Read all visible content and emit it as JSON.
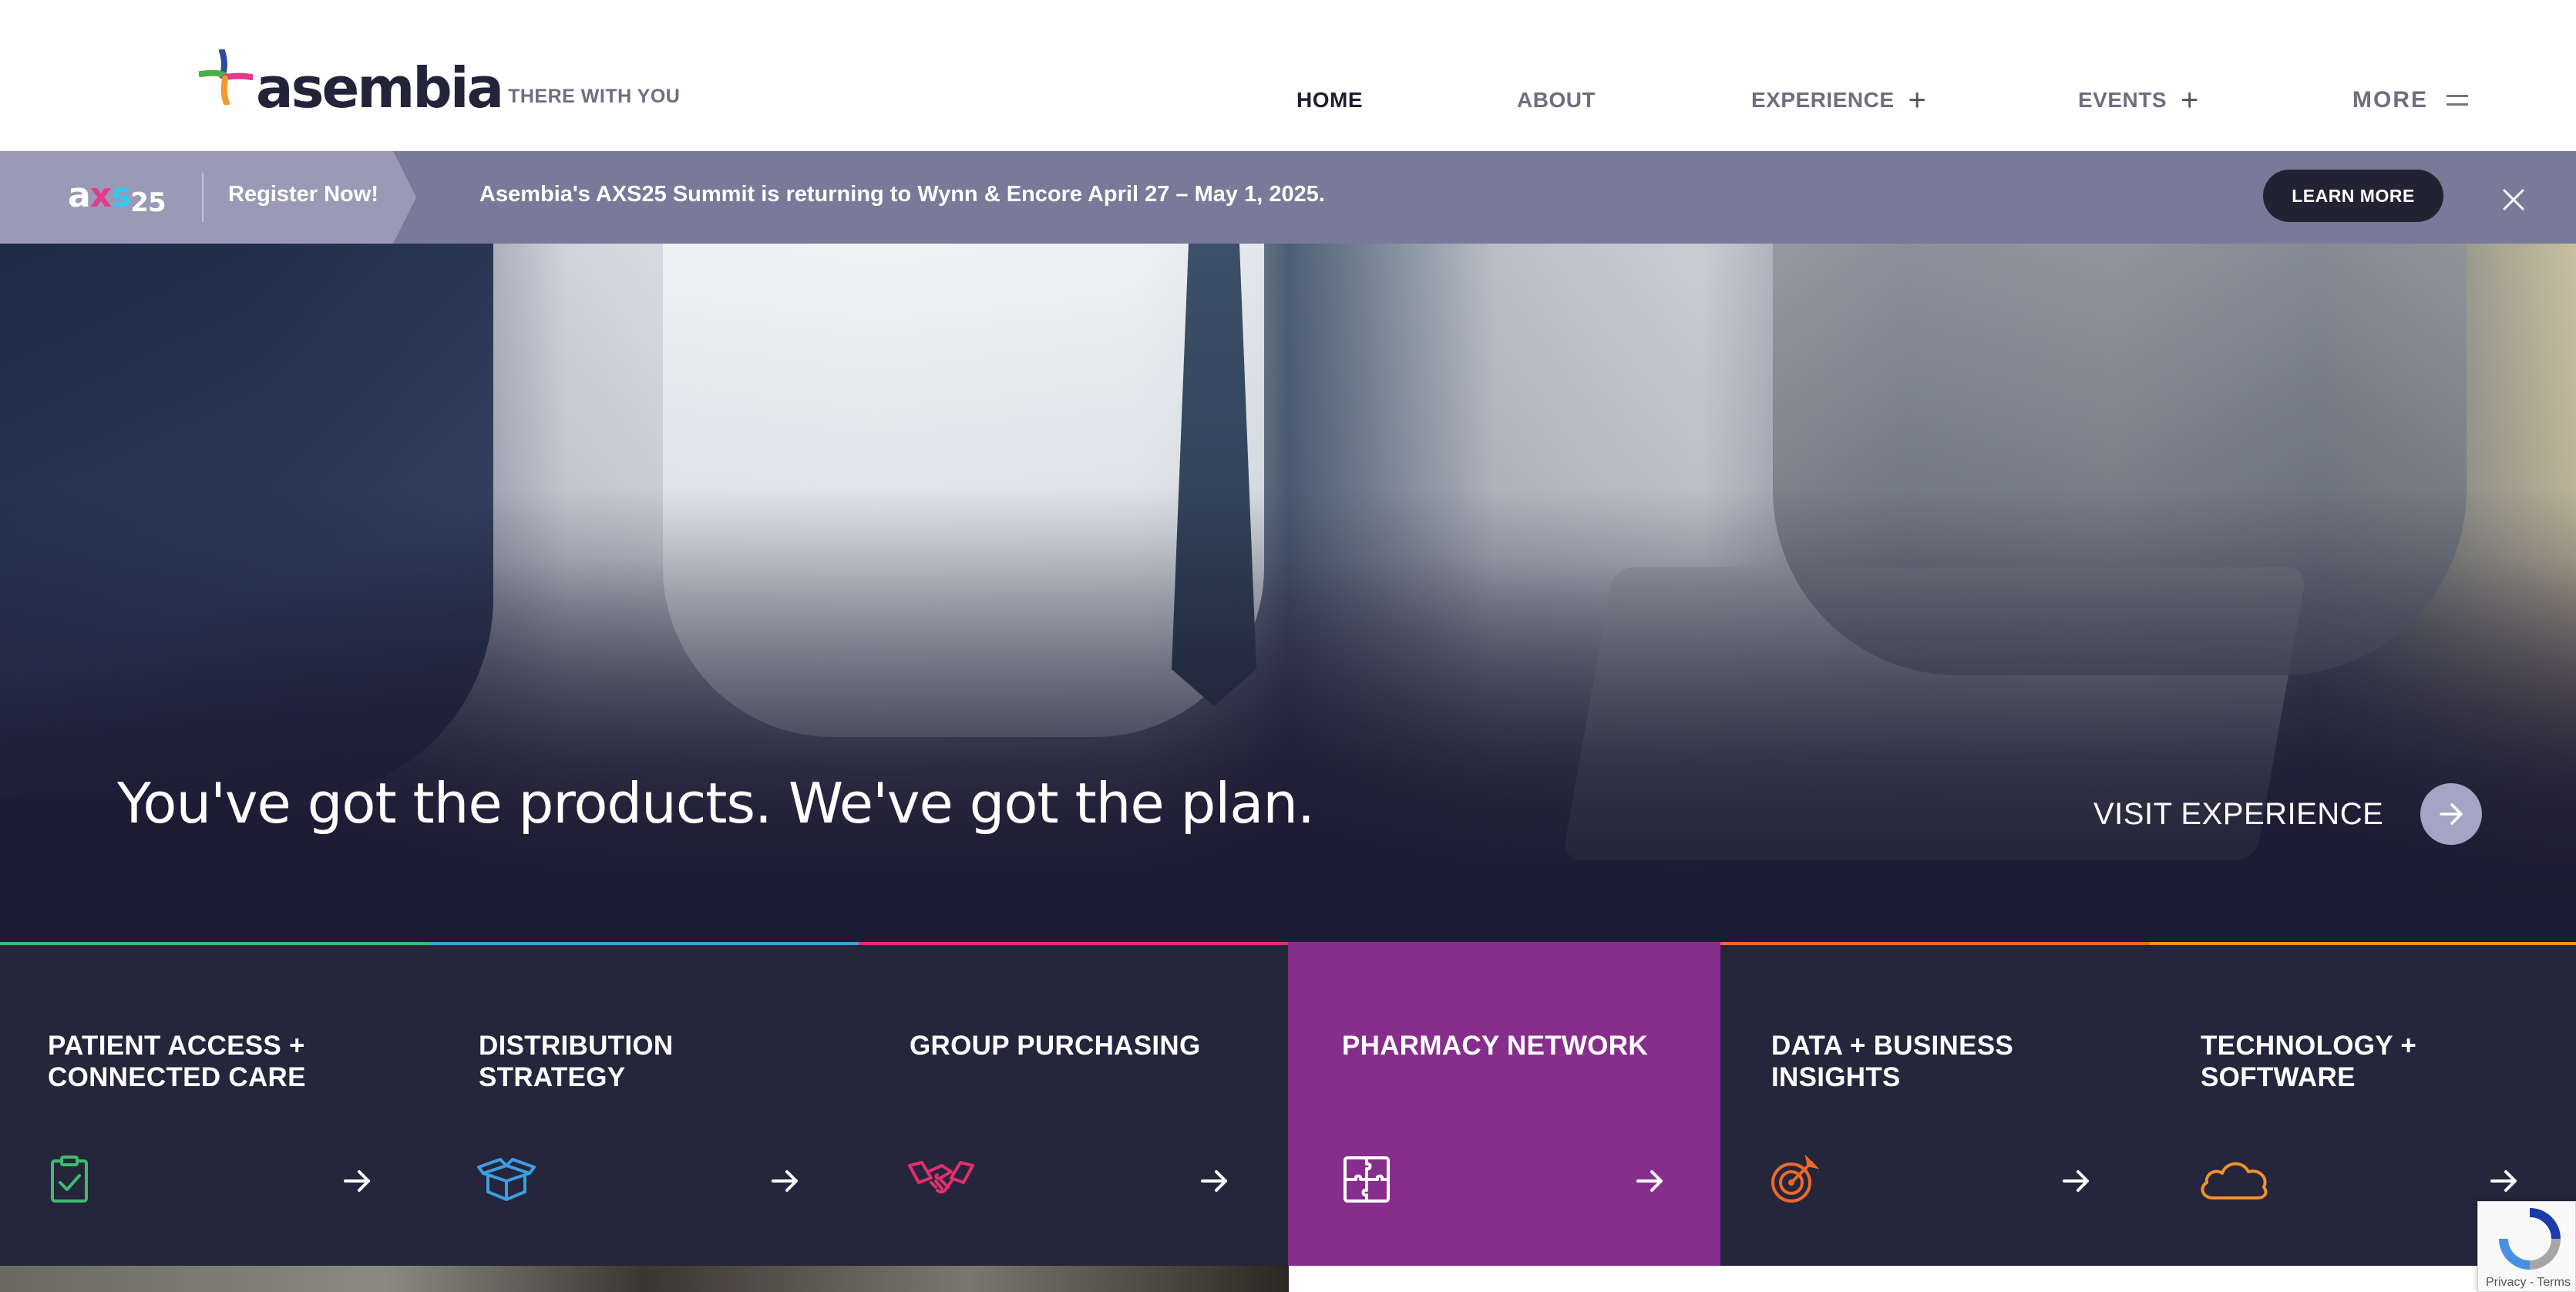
{
  "header": {
    "logo_text": "asembia",
    "tagline": "THERE WITH YOU",
    "nav": [
      {
        "label": "HOME",
        "active": true,
        "expand_icon": null
      },
      {
        "label": "ABOUT",
        "active": false,
        "expand_icon": null
      },
      {
        "label": "EXPERIENCE",
        "active": false,
        "expand_icon": "plus-icon"
      },
      {
        "label": "EVENTS",
        "active": false,
        "expand_icon": "plus-icon"
      },
      {
        "label": "MORE",
        "active": false,
        "expand_icon": "hamburger-icon"
      }
    ]
  },
  "banner": {
    "logo": {
      "a": "a",
      "x": "x",
      "s": "s",
      "num": "25"
    },
    "register_label": "Register Now!",
    "message": "Asembia's AXS25 Summit is returning to Wynn & Encore April 27 – May 1, 2025.",
    "button_label": "LEARN MORE",
    "close_icon": "close-icon"
  },
  "hero": {
    "headline": "You've got the products. We've got the plan.",
    "cta_label": "VISIT EXPERIENCE",
    "cta_icon": "arrow-right-icon"
  },
  "tiles": [
    {
      "line1": "PATIENT ACCESS +",
      "line2": "CONNECTED CARE",
      "icon": "clipboard-check-icon",
      "accent": "#3dbb70",
      "active": false
    },
    {
      "line1": "DISTRIBUTION",
      "line2": "STRATEGY",
      "icon": "open-box-icon",
      "accent": "#3c9fe0",
      "active": false
    },
    {
      "line1": "GROUP PURCHASING",
      "line2": "",
      "icon": "handshake-icon",
      "accent": "#e0306d",
      "active": false
    },
    {
      "line1": "PHARMACY NETWORK",
      "line2": "",
      "icon": "puzzle-icon",
      "accent": "#872e8c",
      "active": true
    },
    {
      "line1": "DATA + BUSINESS",
      "line2": "INSIGHTS",
      "icon": "target-icon",
      "accent": "#ea6a2c",
      "active": false
    },
    {
      "line1": "TECHNOLOGY +",
      "line2": "SOFTWARE",
      "icon": "cloud-icon",
      "accent": "#f0922b",
      "active": false
    }
  ],
  "recaptcha": {
    "footer": "Privacy - Terms"
  }
}
